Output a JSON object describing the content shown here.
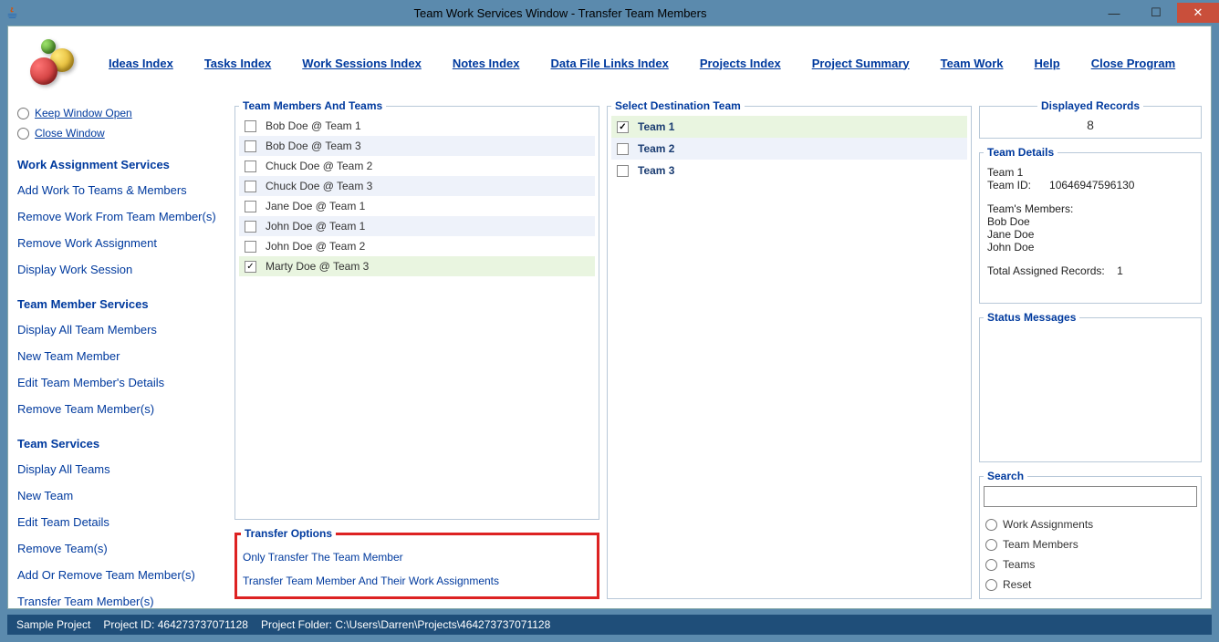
{
  "window": {
    "title": "Team Work Services Window - Transfer Team Members"
  },
  "menu": {
    "ideas": "Ideas Index",
    "tasks": "Tasks Index",
    "work": "Work Sessions Index",
    "notes": "Notes Index",
    "data": "Data File Links Index",
    "projects": "Projects Index",
    "summary": "Project Summary",
    "team": "Team Work",
    "help": "Help",
    "close": "Close Program"
  },
  "radios": {
    "keep": "Keep Window Open",
    "close": "Close Window"
  },
  "side": {
    "work_heading": "Work Assignment Services",
    "work": {
      "add": "Add Work To Teams & Members",
      "remove_from": "Remove Work From Team Member(s)",
      "remove_assign": "Remove Work Assignment",
      "display_session": "Display Work Session"
    },
    "member_heading": "Team Member Services",
    "member": {
      "display_all": "Display All Team Members",
      "new": "New Team Member",
      "edit": "Edit Team Member's Details",
      "remove": "Remove Team Member(s)"
    },
    "team_heading": "Team Services",
    "team": {
      "display_all": "Display All Teams",
      "new": "New Team",
      "edit": "Edit Team Details",
      "remove": "Remove Team(s)",
      "add_remove": "Add Or Remove Team Member(s)",
      "transfer": "Transfer Team Member(s)"
    }
  },
  "members_legend": "Team Members And Teams",
  "members": [
    {
      "label": "Bob Doe @ Team 1",
      "checked": false
    },
    {
      "label": "Bob Doe @ Team 3",
      "checked": false
    },
    {
      "label": "Chuck Doe @ Team 2",
      "checked": false
    },
    {
      "label": "Chuck Doe @ Team 3",
      "checked": false
    },
    {
      "label": "Jane Doe @ Team 1",
      "checked": false
    },
    {
      "label": "John Doe @ Team 1",
      "checked": false
    },
    {
      "label": "John Doe @ Team 2",
      "checked": false
    },
    {
      "label": "Marty Doe @ Team 3",
      "checked": true
    }
  ],
  "transfer_legend": "Transfer Options",
  "transfer": {
    "only": "Only Transfer The Team Member",
    "with_work": "Transfer Team Member And Their Work Assignments"
  },
  "dest_legend": "Select Destination Team",
  "destinations": [
    {
      "label": "Team 1",
      "checked": true
    },
    {
      "label": "Team 2",
      "checked": false
    },
    {
      "label": "Team 3",
      "checked": false
    }
  ],
  "displayed_legend": "Displayed Records",
  "displayed_count": "8",
  "details_legend": "Team Details",
  "details": {
    "team_name": "Team 1",
    "team_id_label": "Team ID:",
    "team_id": "10646947596130",
    "members_label": "Team's Members:",
    "m1": "Bob Doe",
    "m2": "Jane Doe",
    "m3": "John Doe",
    "records_label": "Total Assigned Records:",
    "records_val": "1"
  },
  "status_legend": "Status Messages",
  "search_legend": "Search",
  "search": {
    "work": "Work Assignments",
    "members": "Team Members",
    "teams": "Teams",
    "reset": "Reset"
  },
  "statusbar": {
    "project": "Sample Project",
    "pid_label": "Project ID: ",
    "pid": "464273737071128",
    "folder_label": "Project Folder: ",
    "folder": "C:\\Users\\Darren\\Projects\\464273737071128"
  }
}
